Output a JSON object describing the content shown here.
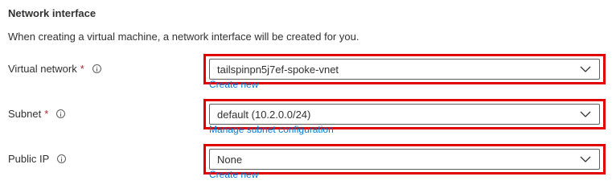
{
  "section": {
    "title": "Network interface",
    "description": "When creating a virtual machine, a network interface will be created for you."
  },
  "fields": [
    {
      "label": "Virtual network",
      "required": "*",
      "icon": "info-icon",
      "value": "tailspinpn5j7ef-spoke-vnet",
      "link": "Create new"
    },
    {
      "label": "Subnet",
      "required": "*",
      "icon": "info-icon",
      "value": "default (10.2.0.0/24)",
      "link": "Manage subnet configuration"
    },
    {
      "label": "Public IP",
      "icon": "info-icon",
      "value": "None",
      "link": "Create new"
    }
  ],
  "colors": {
    "highlight": "#e00000",
    "link": "#0078d4",
    "required": "#a4262c"
  }
}
